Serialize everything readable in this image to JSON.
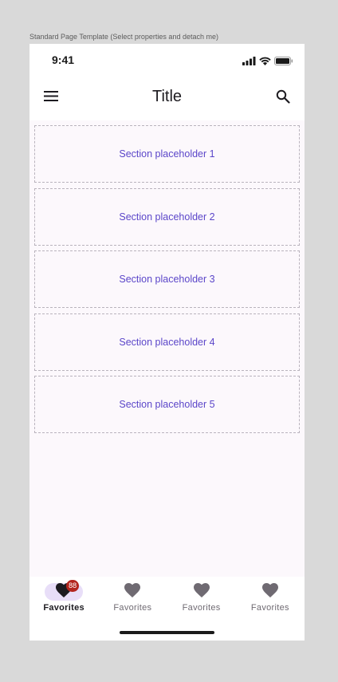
{
  "frame_label": "Standard Page Template (Select properties and detach me)",
  "status_bar": {
    "time": "9:41"
  },
  "app_bar": {
    "title": "Title",
    "leading_icon": "menu-icon",
    "trailing_icon": "search-icon"
  },
  "sections": [
    {
      "label": "Section placeholder 1"
    },
    {
      "label": "Section placeholder 2"
    },
    {
      "label": "Section placeholder 3"
    },
    {
      "label": "Section placeholder 4"
    },
    {
      "label": "Section placeholder 5"
    }
  ],
  "nav": {
    "items": [
      {
        "label": "Favorites",
        "icon": "heart-icon",
        "active": true,
        "badge": "88"
      },
      {
        "label": "Favorites",
        "icon": "heart-icon",
        "active": false
      },
      {
        "label": "Favorites",
        "icon": "heart-icon",
        "active": false
      },
      {
        "label": "Favorites",
        "icon": "heart-icon",
        "active": false
      }
    ]
  },
  "colors": {
    "accent_text": "#5b46c9",
    "active_indicator": "#e8def8",
    "badge": "#b3261e",
    "surface": "#fcf8fc"
  }
}
